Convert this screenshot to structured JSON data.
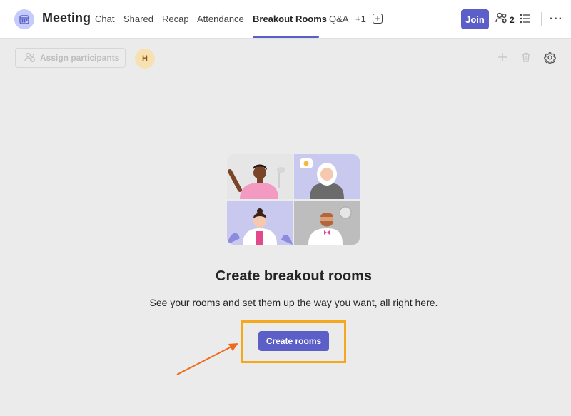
{
  "header": {
    "title": "Meeting",
    "tabs": [
      {
        "label": "Chat"
      },
      {
        "label": "Shared"
      },
      {
        "label": "Recap"
      },
      {
        "label": "Attendance"
      },
      {
        "label": "Breakout Rooms"
      },
      {
        "label": "Q&A"
      },
      {
        "label": "+1"
      }
    ],
    "active_tab": "Breakout Rooms",
    "join_label": "Join",
    "participant_count": "2",
    "icons": [
      "calendar-icon",
      "add-tab-icon",
      "people-icon",
      "list-icon",
      "more-icon"
    ]
  },
  "toolbar": {
    "assign_label": "Assign participants",
    "avatar_initial": "H",
    "icons": [
      "add-icon",
      "trash-icon",
      "settings-icon"
    ]
  },
  "main": {
    "title": "Create breakout rooms",
    "subtitle": "See your rooms and set them up the way you want, all right here.",
    "create_label": "Create rooms"
  },
  "colors": {
    "brand": "#5b5fc7",
    "highlight": "#f6a81c",
    "arrow": "#f06a1d",
    "background": "#ebebeb"
  }
}
